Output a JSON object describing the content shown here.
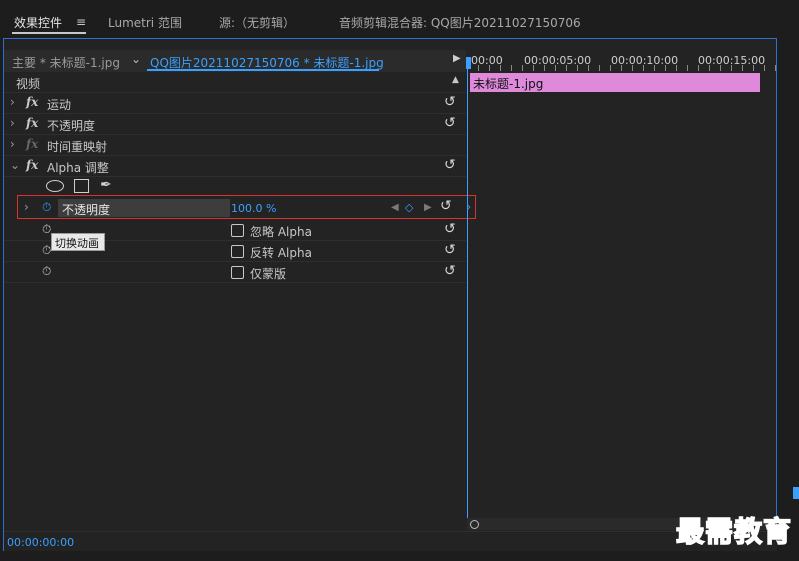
{
  "tabs": [
    {
      "label": "效果控件",
      "active": true
    },
    {
      "label": "Lumetri 范围"
    },
    {
      "label": "源:（无剪辑）"
    },
    {
      "label": "音频剪辑混合器: QQ图片20211027150706"
    }
  ],
  "clipbar": {
    "main": "主要 * 未标题-1.jpg",
    "sequence": "QQ图片20211027150706 * 未标题-1.jpg"
  },
  "section_label": "视频",
  "effects": [
    {
      "label": "运动"
    },
    {
      "label": "不透明度"
    },
    {
      "label": "时间重映射"
    },
    {
      "label": "Alpha 调整"
    }
  ],
  "alpha": {
    "opacity_label": "不透明度",
    "opacity_value": "100.0 %",
    "tooltip": "切换动画",
    "checkboxes": [
      {
        "label": "忽略 Alpha",
        "checked": false
      },
      {
        "label": "反转 Alpha",
        "checked": false
      },
      {
        "label": "仅蒙版",
        "checked": false
      }
    ]
  },
  "timeline": {
    "ticks": [
      "00:00",
      "00:00:05:00",
      "00:00:10:00",
      "00:00:15:00"
    ],
    "clip_label": "未标题-1.jpg"
  },
  "status": {
    "timecode": "00:00:00:00"
  },
  "watermark": "最需教育",
  "colors": {
    "accent": "#3aa0ff",
    "clip": "#de89da",
    "highlight": "#d8342b",
    "panel_border": "#2d6fd6"
  }
}
